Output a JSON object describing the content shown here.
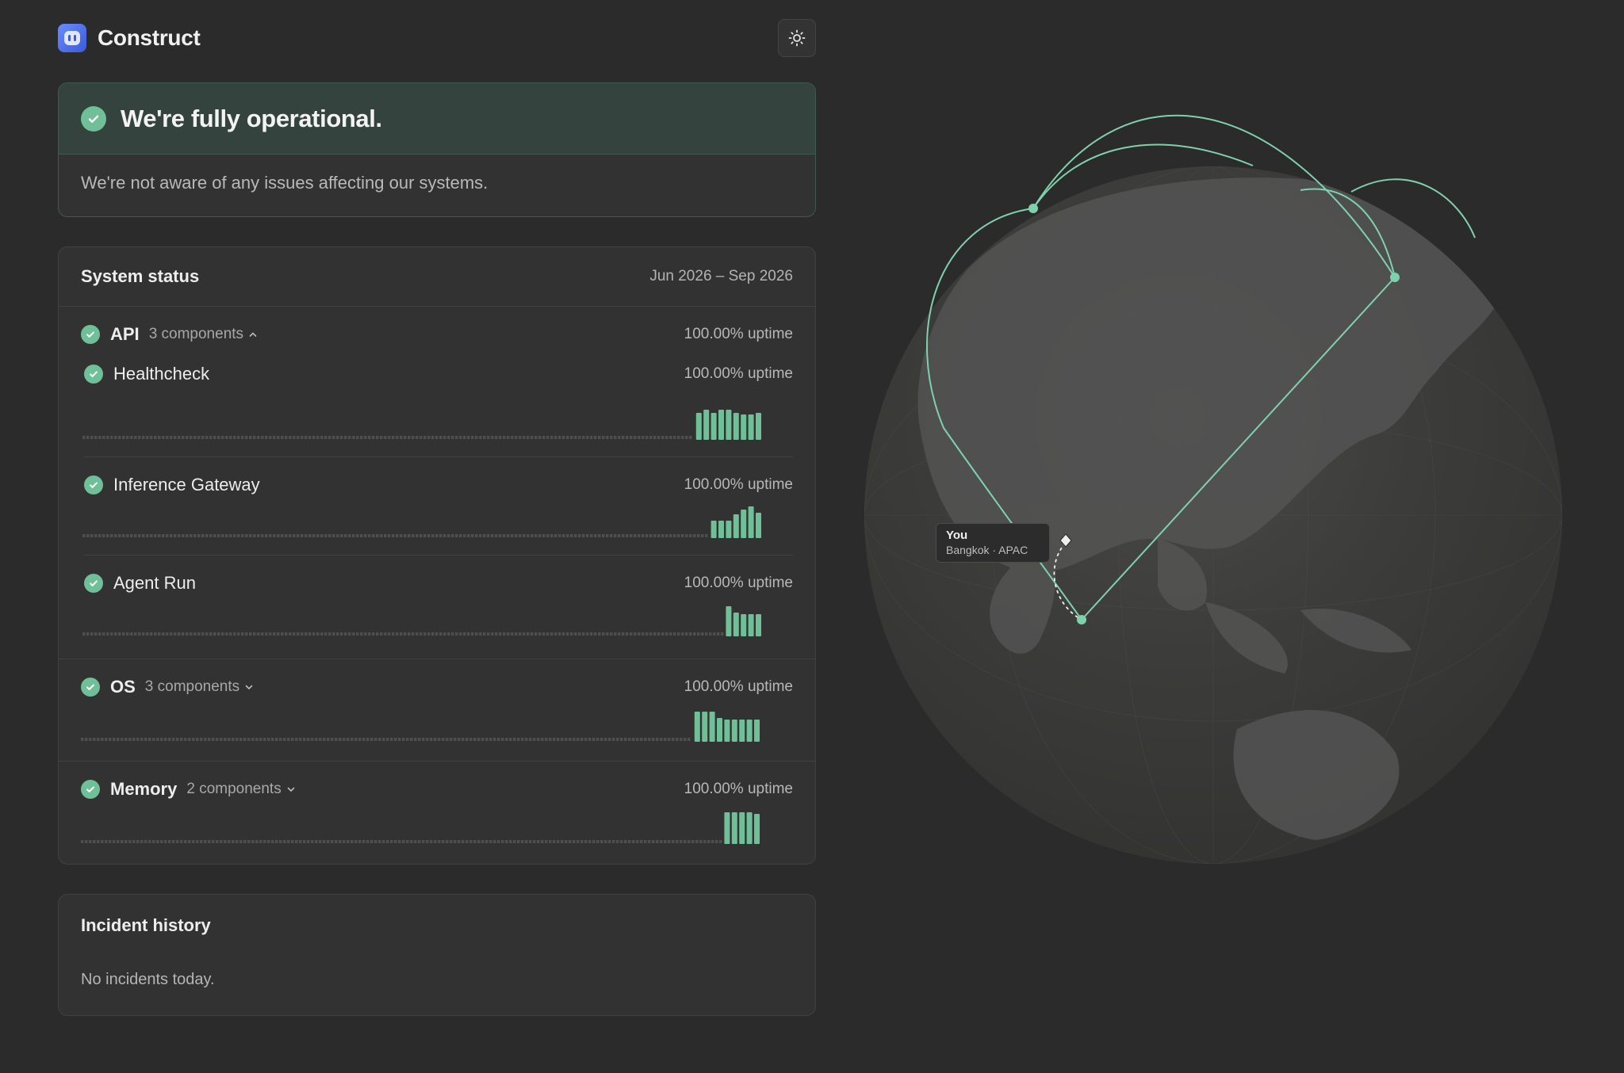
{
  "app": {
    "name": "Construct"
  },
  "theme_toggle": {
    "icon": "sun-icon"
  },
  "status_banner": {
    "title": "We're fully operational.",
    "message": "We're not aware of any issues affecting our systems."
  },
  "system_status": {
    "title": "System status",
    "range": "Jun 2026 – Sep 2026",
    "groups": [
      {
        "name": "API",
        "components_label": "3 components",
        "expanded": true,
        "uptime": "100.00% uptime",
        "children": [
          {
            "name": "Healthcheck",
            "uptime": "100.00% uptime",
            "bars": [
              0.85,
              0.95,
              0.85,
              0.95,
              0.95,
              0.85,
              0.8,
              0.8,
              0.85
            ],
            "status": "operational"
          },
          {
            "name": "Inference Gateway",
            "uptime": "100.00% uptime",
            "bars": [
              0.55,
              0.55,
              0.55,
              0.75,
              0.9,
              1.0,
              0.8
            ],
            "status": "operational"
          },
          {
            "name": "Agent Run",
            "uptime": "100.00% uptime",
            "bars": [
              0.95,
              0.75,
              0.7,
              0.7,
              0.7
            ],
            "status": "operational"
          }
        ]
      },
      {
        "name": "OS",
        "components_label": "3 components",
        "expanded": false,
        "uptime": "100.00% uptime",
        "bars": [
          0.95,
          0.95,
          0.95,
          0.75,
          0.7,
          0.7,
          0.7,
          0.7,
          0.7
        ],
        "status": "operational"
      },
      {
        "name": "Memory",
        "components_label": "2 components",
        "expanded": false,
        "uptime": "100.00% uptime",
        "bars": [
          1.0,
          1.0,
          1.0,
          1.0,
          0.95
        ],
        "status": "operational"
      }
    ]
  },
  "incident_history": {
    "title": "Incident history",
    "message": "No incidents today."
  },
  "map": {
    "you_label": "You",
    "location": "Bangkok · APAC"
  },
  "colors": {
    "accent": "#6fbf98",
    "background": "#2b2b2b",
    "card": "#323232"
  }
}
